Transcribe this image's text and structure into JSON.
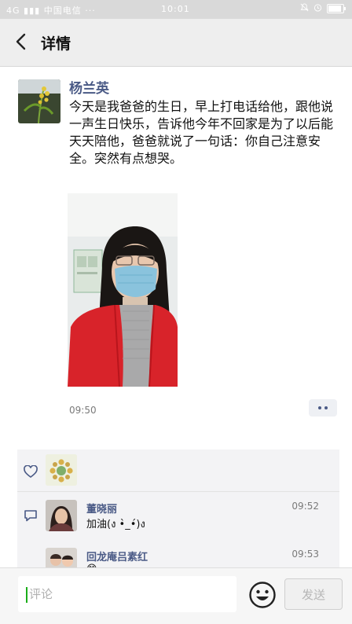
{
  "status_bar": {
    "carrier": "中国电信",
    "signal_text": "4G",
    "time": "10:01"
  },
  "header": {
    "title": "详情"
  },
  "post": {
    "author": "杨兰英",
    "text": "今天是我爸爸的生日，早上打电话给他，跟他说一声生日快乐，告诉他今年不回家是为了以后能天天陪他，爸爸就说了一句话：你自己注意安全。突然有点想哭。",
    "time": "09:50",
    "more_icon": "ellipsis-icon"
  },
  "likes": {
    "icon": "heart-icon",
    "count": 1
  },
  "comments": [
    {
      "name": "董晓丽",
      "time": "09:52",
      "text": "加油(ง •̀_•́)ง"
    },
    {
      "name": "回龙庵吕素红",
      "time": "09:53",
      "text": "😊"
    }
  ],
  "input_bar": {
    "placeholder": "评论",
    "send_label": "发送",
    "emoji_icon": "smiley-icon"
  },
  "colors": {
    "name_blue": "#4a5a86",
    "caret_green": "#1aad19",
    "status_bar_bg": "#d9d9d9",
    "nav_bg": "#eeeeee"
  }
}
